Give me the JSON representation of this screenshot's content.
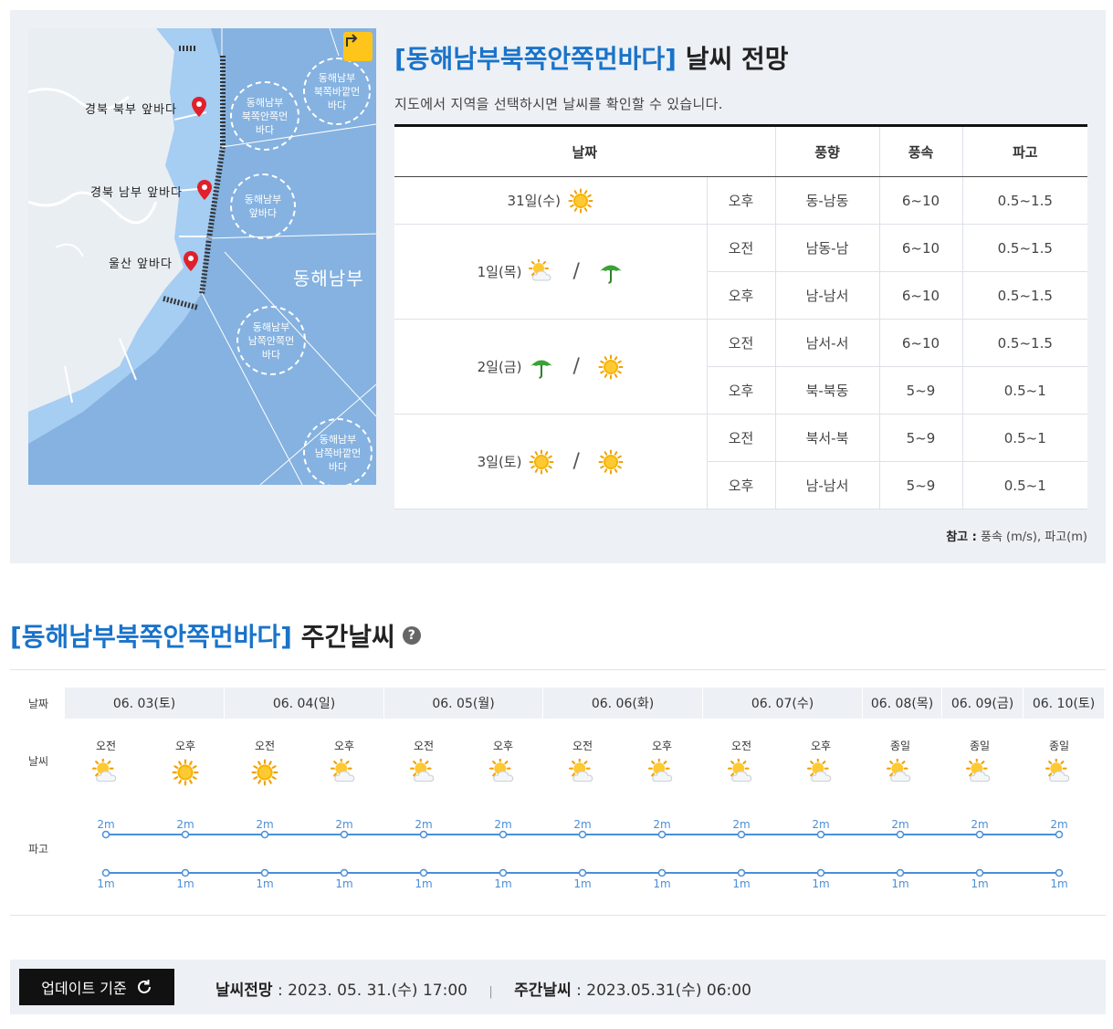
{
  "forecast": {
    "title_region": "[동해남부북쪽안쪽먼바다]",
    "title_suffix": "날씨 전망",
    "subtitle": "지도에서 지역을 선택하시면 날씨를 확인할 수 있습니다.",
    "headers": [
      "날짜",
      "풍향",
      "풍속",
      "파고"
    ],
    "days": [
      {
        "date": "31일(수)",
        "icons": [
          "sun"
        ],
        "rows": [
          {
            "period": "오후",
            "wind_dir": "동-남동",
            "wind_speed": "6~10",
            "wave": "0.5~1.5"
          }
        ]
      },
      {
        "date": "1일(목)",
        "icons": [
          "sun-cloud",
          "umbrella"
        ],
        "rows": [
          {
            "period": "오전",
            "wind_dir": "남동-남",
            "wind_speed": "6~10",
            "wave": "0.5~1.5"
          },
          {
            "period": "오후",
            "wind_dir": "남-남서",
            "wind_speed": "6~10",
            "wave": "0.5~1.5"
          }
        ]
      },
      {
        "date": "2일(금)",
        "icons": [
          "umbrella",
          "sun"
        ],
        "rows": [
          {
            "period": "오전",
            "wind_dir": "남서-서",
            "wind_speed": "6~10",
            "wave": "0.5~1.5"
          },
          {
            "period": "오후",
            "wind_dir": "북-북동",
            "wind_speed": "5~9",
            "wave": "0.5~1"
          }
        ]
      },
      {
        "date": "3일(토)",
        "icons": [
          "sun",
          "sun"
        ],
        "rows": [
          {
            "period": "오전",
            "wind_dir": "북서-북",
            "wind_speed": "5~9",
            "wave": "0.5~1"
          },
          {
            "period": "오후",
            "wind_dir": "남-남서",
            "wind_speed": "5~9",
            "wave": "0.5~1"
          }
        ]
      }
    ],
    "slash": "/",
    "note_label": "참고 :",
    "note_text": "풍속 (m/s), 파고(m)"
  },
  "map": {
    "markers": [
      "경북 북부 앞바다",
      "경북 남부 앞바다",
      "울산 앞바다"
    ],
    "zones": [
      "동해남부\n북쪽안쪽먼\n바다",
      "동해남부\n북쪽바깥먼\n바다",
      "동해남부\n앞바다",
      "동해남부\n남쪽안쪽먼\n바다",
      "동해남부\n남쪽바깥먼\n바다"
    ],
    "sea_label": "동해남부",
    "toggle_icon": "expand-arrow-icon"
  },
  "weekly": {
    "title_region": "[동해남부북쪽안쪽먼바다]",
    "title_suffix": "주간날씨",
    "help": "?",
    "row_labels": {
      "date": "날짜",
      "weather": "날씨",
      "wave": "파고"
    },
    "dates": [
      "06. 03(토)",
      "06. 04(일)",
      "06. 05(월)",
      "06. 06(화)",
      "06. 07(수)",
      "06. 08(목)",
      "06. 09(금)",
      "06. 10(토)"
    ],
    "slots": [
      {
        "period": "오전",
        "icon": "sun-cloud",
        "wave_max": "2m",
        "wave_min": "1m"
      },
      {
        "period": "오후",
        "icon": "sun",
        "wave_max": "2m",
        "wave_min": "1m"
      },
      {
        "period": "오전",
        "icon": "sun",
        "wave_max": "2m",
        "wave_min": "1m"
      },
      {
        "period": "오후",
        "icon": "sun-cloud",
        "wave_max": "2m",
        "wave_min": "1m"
      },
      {
        "period": "오전",
        "icon": "sun-cloud",
        "wave_max": "2m",
        "wave_min": "1m"
      },
      {
        "period": "오후",
        "icon": "sun-cloud",
        "wave_max": "2m",
        "wave_min": "1m"
      },
      {
        "period": "오전",
        "icon": "sun-cloud",
        "wave_max": "2m",
        "wave_min": "1m"
      },
      {
        "period": "오후",
        "icon": "sun-cloud",
        "wave_max": "2m",
        "wave_min": "1m"
      },
      {
        "period": "오전",
        "icon": "sun-cloud",
        "wave_max": "2m",
        "wave_min": "1m"
      },
      {
        "period": "오후",
        "icon": "sun-cloud",
        "wave_max": "2m",
        "wave_min": "1m"
      },
      {
        "period": "종일",
        "icon": "sun-cloud",
        "wave_max": "2m",
        "wave_min": "1m"
      },
      {
        "period": "종일",
        "icon": "sun-cloud",
        "wave_max": "2m",
        "wave_min": "1m"
      },
      {
        "period": "종일",
        "icon": "sun-cloud",
        "wave_max": "2m",
        "wave_min": "1m"
      }
    ]
  },
  "footer": {
    "update_button": "업데이트 기준",
    "forecast_label": "날씨전망",
    "forecast_time": ": 2023. 05. 31.(수) 17:00",
    "separator": "|",
    "weekly_label": "주간날씨",
    "weekly_time": ": 2023.05.31(수) 06:00"
  },
  "colors": {
    "accent": "#1a73c9",
    "panel": "#edf0f4",
    "sea": "#85b2e0",
    "coast_sea": "#a6cdf2",
    "wave_line": "#4a8fd6",
    "toggle": "#ffc51a"
  }
}
